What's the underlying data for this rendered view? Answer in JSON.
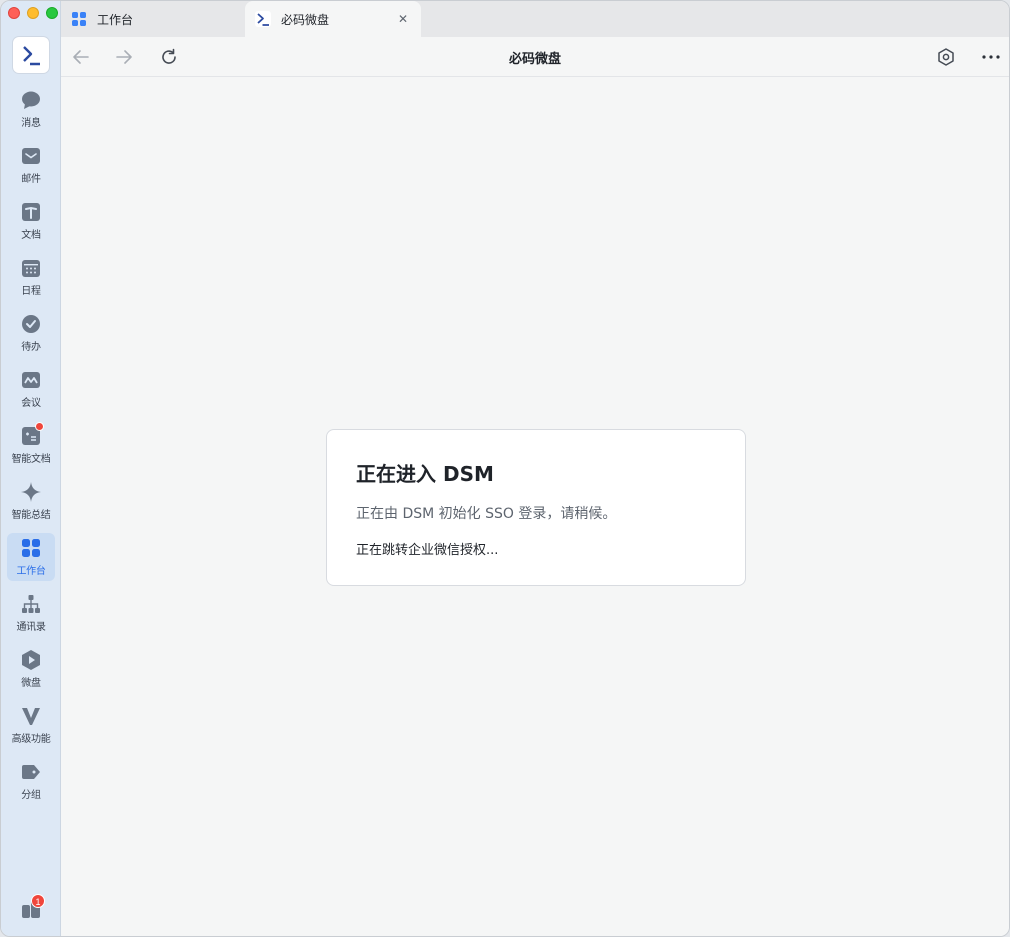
{
  "sidebar": {
    "items": [
      {
        "label": "消息",
        "icon": "message-icon"
      },
      {
        "label": "邮件",
        "icon": "mail-icon"
      },
      {
        "label": "文档",
        "icon": "document-icon"
      },
      {
        "label": "日程",
        "icon": "calendar-icon"
      },
      {
        "label": "待办",
        "icon": "todo-icon"
      },
      {
        "label": "会议",
        "icon": "meeting-icon"
      },
      {
        "label": "智能文档",
        "icon": "smart-doc-icon"
      },
      {
        "label": "智能总结",
        "icon": "sparkle-icon"
      },
      {
        "label": "工作台",
        "icon": "workbench-icon",
        "active": true
      },
      {
        "label": "通讯录",
        "icon": "contacts-icon"
      },
      {
        "label": "微盘",
        "icon": "drive-icon"
      },
      {
        "label": "高级功能",
        "icon": "advanced-icon"
      },
      {
        "label": "分组",
        "icon": "tag-icon"
      }
    ],
    "bottom_badge": "1"
  },
  "tabs": [
    {
      "label": "工作台"
    },
    {
      "label": "必码微盘"
    }
  ],
  "toolbar": {
    "title": "必码微盘"
  },
  "card": {
    "title": "正在进入 DSM",
    "subtitle": "正在由 DSM 初始化 SSO 登录，请稍候。",
    "status": "正在跳转企业微信授权..."
  },
  "colors": {
    "accent": "#2a6ee8",
    "sidebar_bg": "#dde8f5",
    "icon_gray": "#6b7787",
    "badge_red": "#f0463c"
  }
}
